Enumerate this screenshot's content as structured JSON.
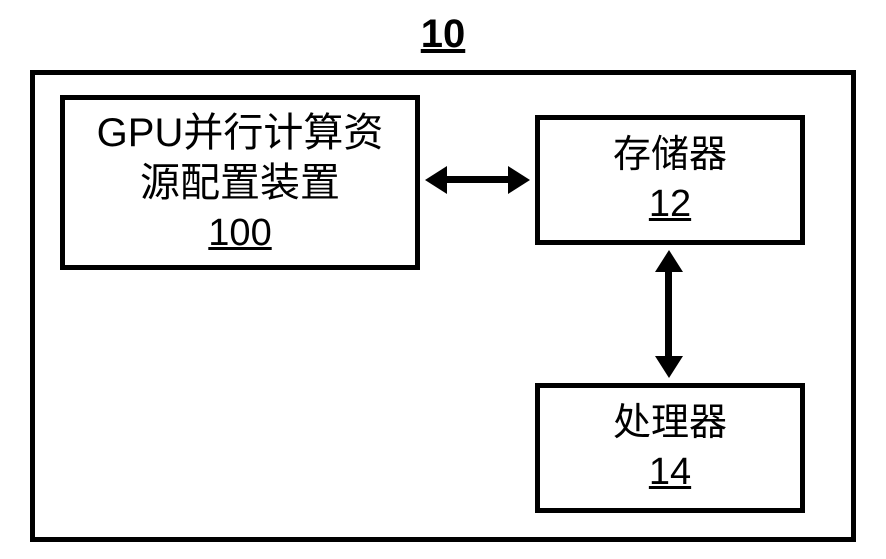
{
  "title": "10",
  "boxes": {
    "gpu": {
      "line1": "GPU并行计算资",
      "line2": "源配置装置",
      "num": "100"
    },
    "mem": {
      "label": "存储器",
      "num": "12"
    },
    "proc": {
      "label": "处理器",
      "num": "14"
    }
  }
}
